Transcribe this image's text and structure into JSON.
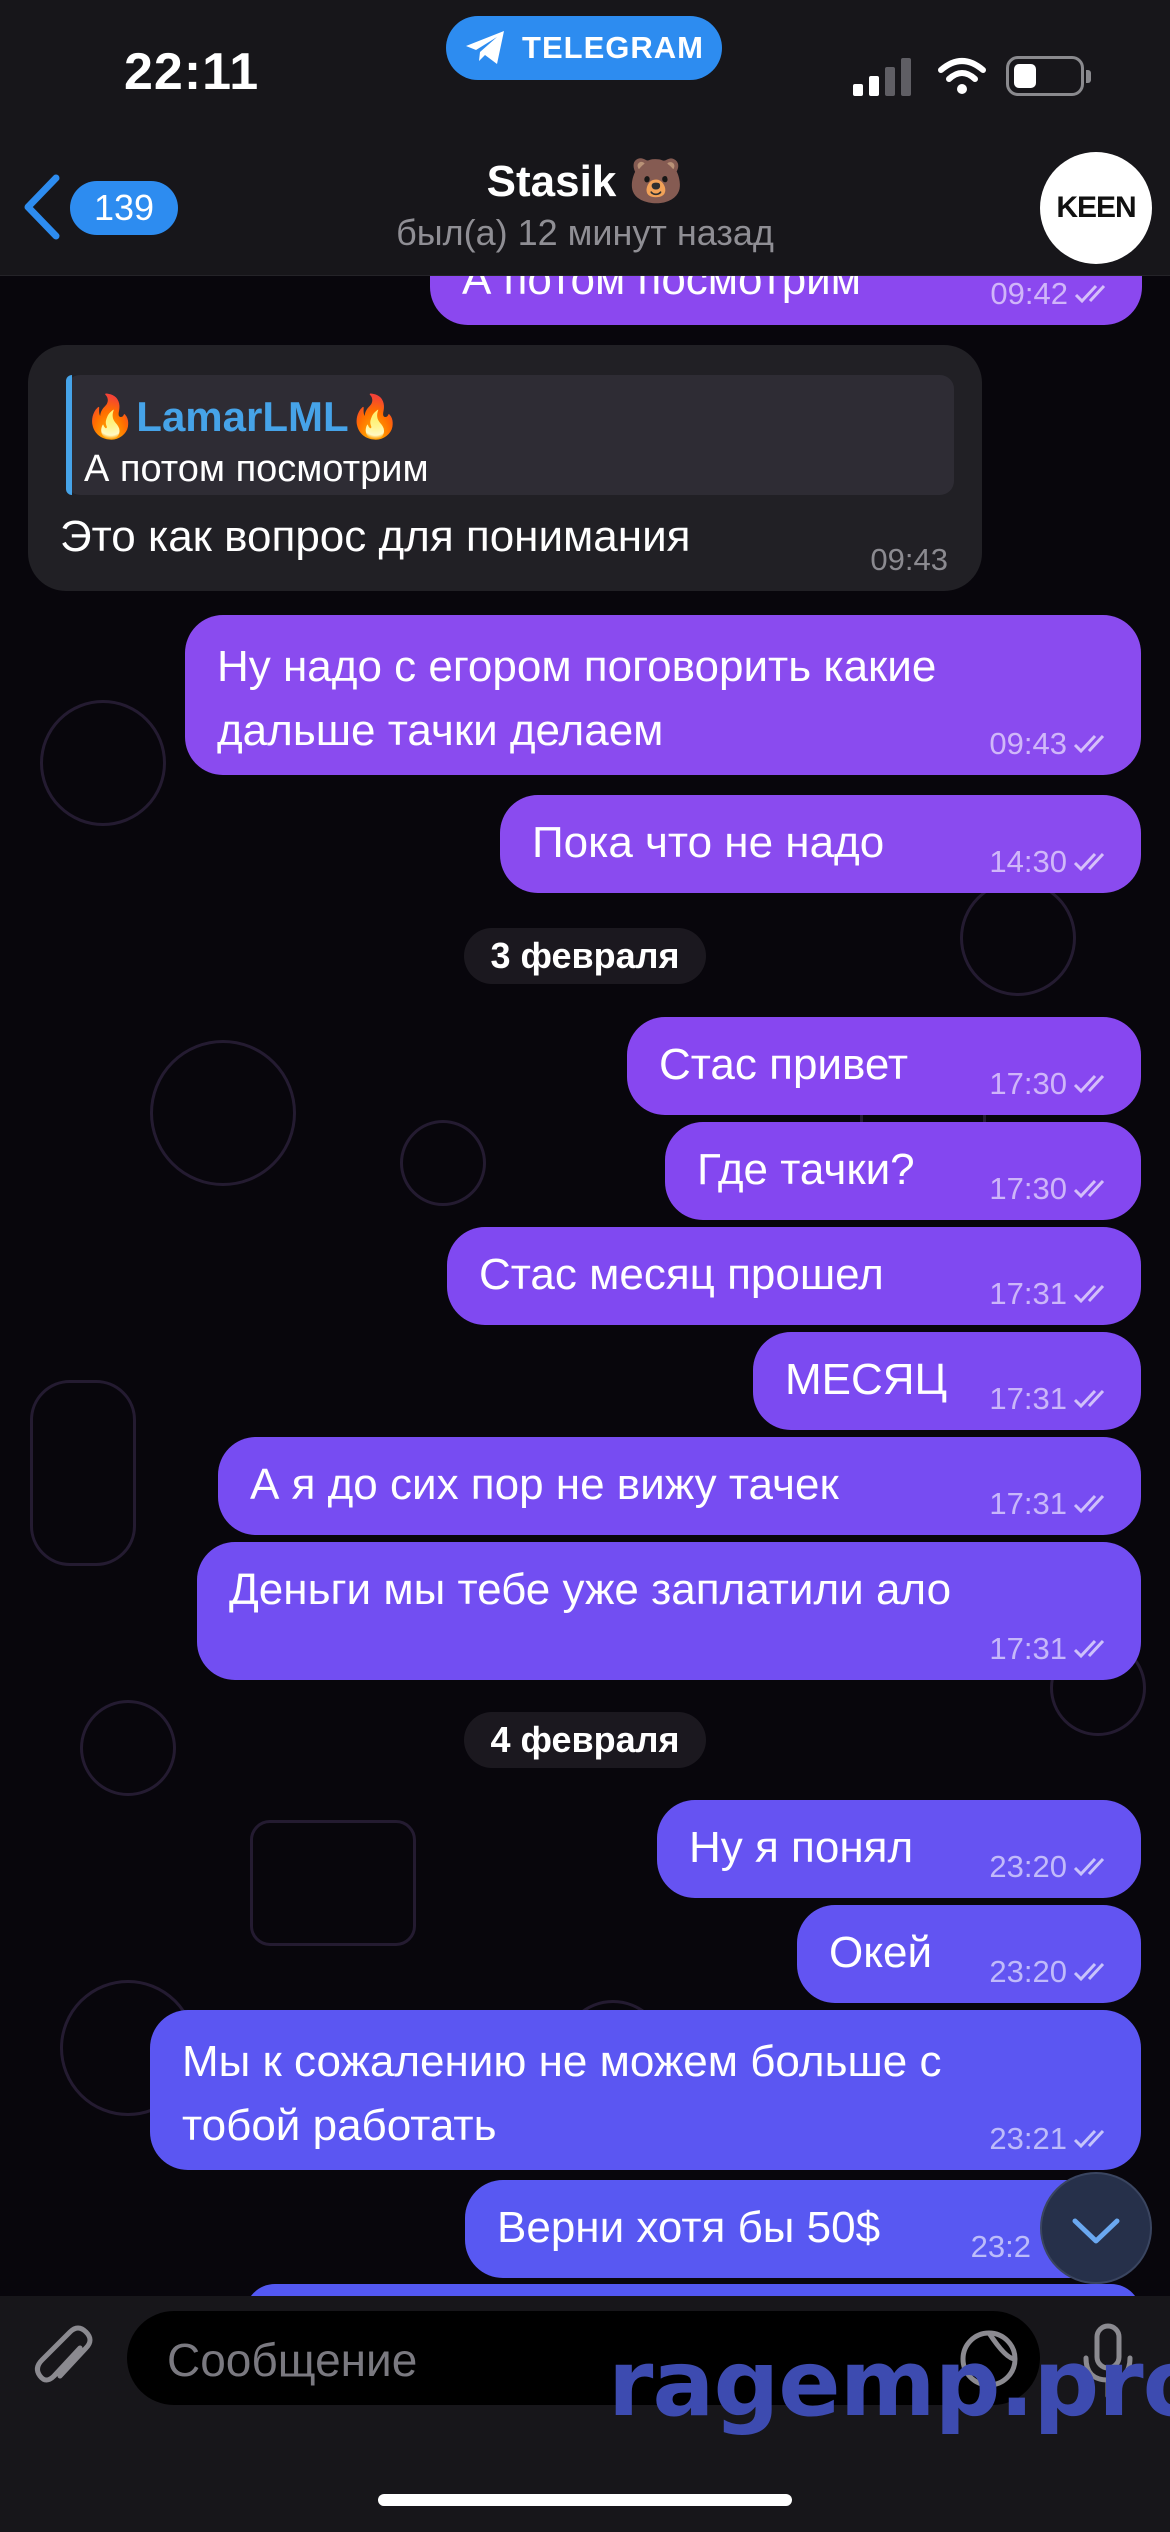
{
  "status_bar": {
    "time": "22:11",
    "app_pill": "TELEGRAM"
  },
  "header": {
    "back_count": "139",
    "title": "Stasik",
    "subtitle": "был(а) 12 минут назад",
    "avatar_text": "KEEN"
  },
  "messages": [
    {
      "dir": "out",
      "text": "А потом посмотрим",
      "time": "09:42"
    },
    {
      "dir": "in",
      "reply_name": "LamarLML",
      "reply_text": "А потом посмотрим",
      "text": "Это как вопрос для понимания",
      "time": "09:43"
    },
    {
      "dir": "out",
      "text": "Ну надо с егором поговорить какие",
      "text2": "дальше тачки делаем",
      "time": "09:43"
    },
    {
      "dir": "out",
      "text": "Пока что не надо",
      "time": "14:30"
    },
    {
      "dir": "out",
      "text": "Стас привет",
      "time": "17:30"
    },
    {
      "dir": "out",
      "text": "Где тачки?",
      "time": "17:30"
    },
    {
      "dir": "out",
      "text": "Стас месяц прошел",
      "time": "17:31"
    },
    {
      "dir": "out",
      "text": "МЕСЯЦ",
      "time": "17:31"
    },
    {
      "dir": "out",
      "text": "А я до сих пор не вижу тачек",
      "time": "17:31"
    },
    {
      "dir": "out",
      "text": "Деньги мы тебе уже заплатили ало",
      "time": "17:31"
    },
    {
      "dir": "out",
      "text": "Ну я понял",
      "time": "23:20"
    },
    {
      "dir": "out",
      "text": "Окей",
      "time": "23:20"
    },
    {
      "dir": "out",
      "text": "Мы к сожалению не можем больше с",
      "text2": "тобой работать",
      "time": "23:21"
    },
    {
      "dir": "out",
      "text": "Верни хотя бы 50$",
      "time": "23:2"
    }
  ],
  "dates": [
    "3 февраля",
    "4 февраля"
  ],
  "input": {
    "placeholder": "Сообщение"
  },
  "watermark": "ragemp.pro",
  "colors": {
    "accent": "#2d8cf0",
    "bubble_purple": "#8a4cf0",
    "bubble_blue": "#5a55f2",
    "incoming": "#212025"
  },
  "icons": [
    "telegram-icon",
    "back-chevron-icon",
    "signal-icon",
    "wifi-icon",
    "battery-icon",
    "fire-icon",
    "double-check-icon",
    "paperclip-icon",
    "sticker-icon",
    "microphone-icon",
    "chevron-down-icon"
  ]
}
